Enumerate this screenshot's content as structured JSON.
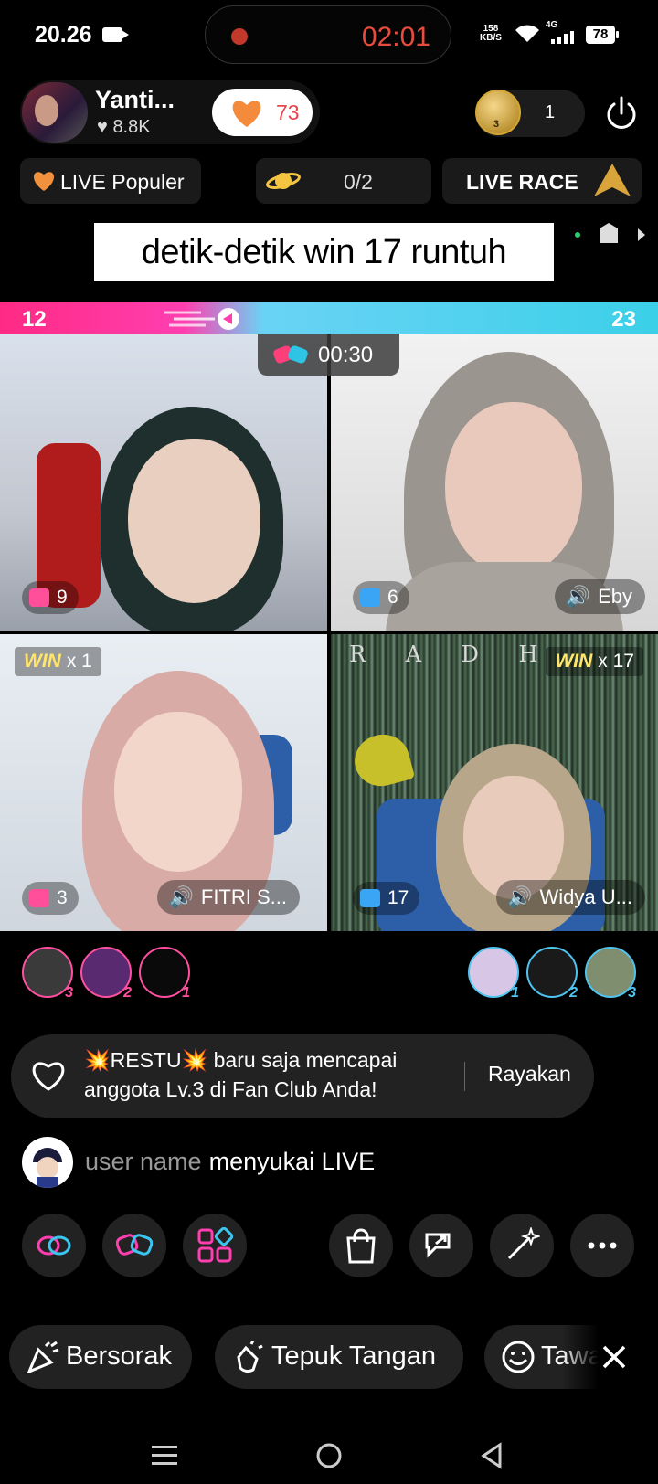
{
  "status_bar": {
    "time": "20.26",
    "record_timer": "02:01",
    "net_speed_value": "158",
    "net_speed_unit": "KB/S",
    "signal_label": "4G",
    "battery": "78"
  },
  "host": {
    "name": "Yanti...",
    "likes": "8.8K",
    "heart_count": "73"
  },
  "fan_club": {
    "count": "1",
    "badge_level": "3"
  },
  "chips": {
    "popular": "LIVE Populer",
    "planet": "0/2",
    "race": "LIVE RACE"
  },
  "caption": "detik-detik win 17 runtuh",
  "battle": {
    "left_score": "12",
    "right_score": "23",
    "timer": "00:30"
  },
  "tiles": [
    {
      "gifts": "9",
      "name": "",
      "win": ""
    },
    {
      "gifts": "6",
      "name": "Eby",
      "win": ""
    },
    {
      "gifts": "3",
      "name": "FITRI S...",
      "win_label": "WIN",
      "win": "x 1"
    },
    {
      "gifts": "17",
      "name": "Widya U...",
      "win_label": "WIN",
      "win": "x 17"
    }
  ],
  "supporters_left": [
    "3",
    "2",
    "1"
  ],
  "supporters_right": [
    "1",
    "2",
    "3"
  ],
  "notification": {
    "line1": "💥RESTU💥 baru saja mencapai",
    "line2": "anggota Lv.3 di Fan Club Anda!",
    "action": "Rayakan"
  },
  "comment": {
    "user": "user name",
    "text": "menyukai LIVE"
  },
  "reactions": [
    "Bersorak",
    "Tepuk Tangan",
    "Tawa"
  ],
  "colors": {
    "pink": "#ff2a84",
    "cyan": "#3bd0e8",
    "accent_red": "#e8454e"
  }
}
